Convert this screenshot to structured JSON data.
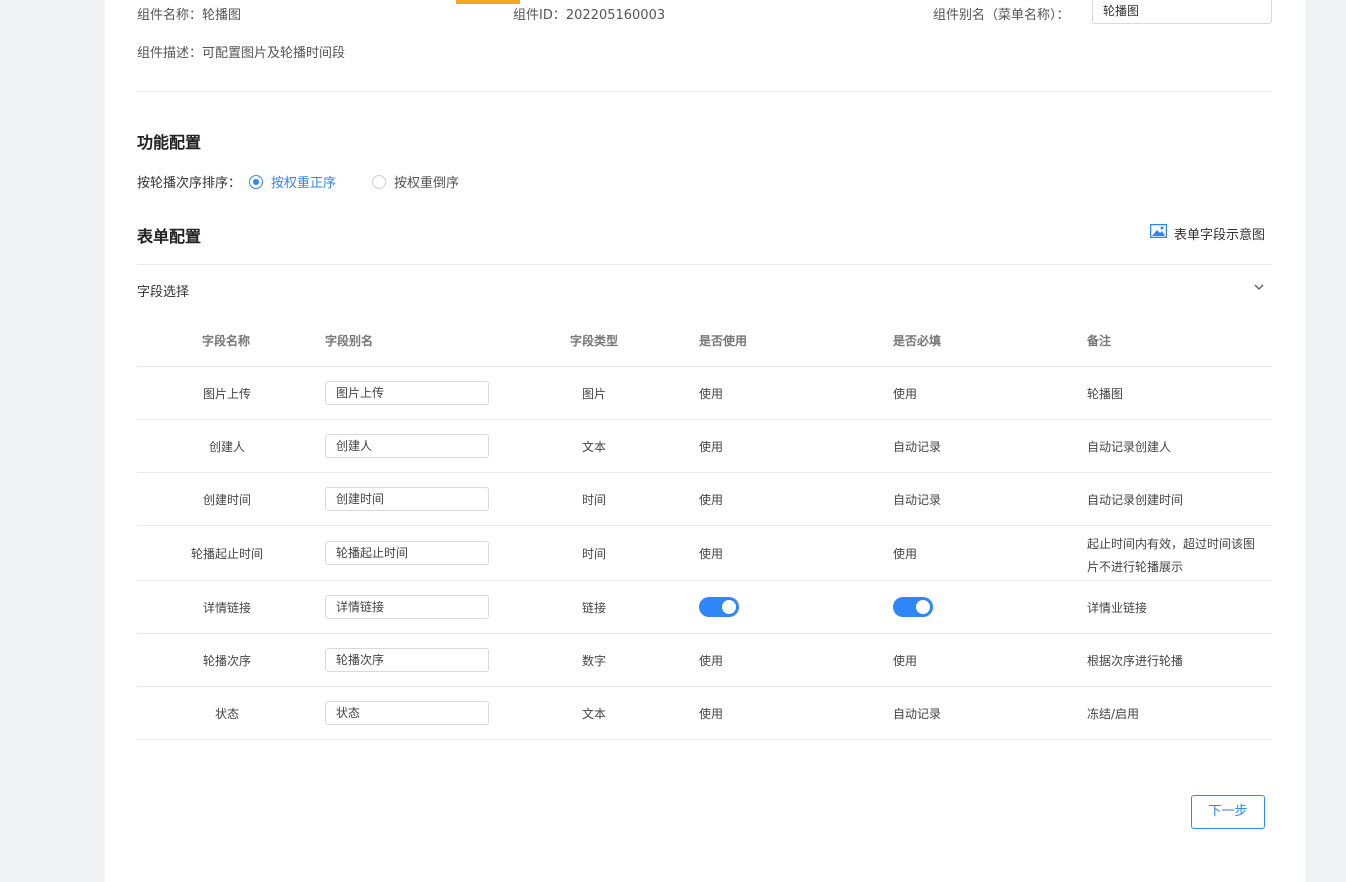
{
  "component": {
    "name_label": "组件名称：",
    "name_value": "轮播图",
    "id_label": "组件ID：",
    "id_value": "202205160003",
    "alias_label": "组件别名（菜单名称）：",
    "alias_value": "轮播图",
    "desc_label": "组件描述：",
    "desc_value": "可配置图片及轮播时间段"
  },
  "function_config": {
    "title": "功能配置",
    "sort_label": "按轮播次序排序：",
    "options": [
      {
        "label": "按权重正序",
        "selected": true
      },
      {
        "label": "按权重倒序",
        "selected": false
      }
    ]
  },
  "form_config": {
    "title": "表单配置",
    "schematic_label": "表单字段示意图",
    "field_select_label": "字段选择",
    "columns": [
      "字段名称",
      "字段别名",
      "字段类型",
      "是否使用",
      "是否必填",
      "备注"
    ],
    "rows": [
      {
        "name": "图片上传",
        "alias": "图片上传",
        "type": "图片",
        "use": "使用",
        "required": "使用",
        "note": "轮播图",
        "toggles": false
      },
      {
        "name": "创建人",
        "alias": "创建人",
        "type": "文本",
        "use": "使用",
        "required": "自动记录",
        "note": "自动记录创建人",
        "toggles": false
      },
      {
        "name": "创建时间",
        "alias": "创建时间",
        "type": "时间",
        "use": "使用",
        "required": "自动记录",
        "note": "自动记录创建时间",
        "toggles": false
      },
      {
        "name": "轮播起止时间",
        "alias": "轮播起止时间",
        "type": "时间",
        "use": "使用",
        "required": "使用",
        "note_line1": "起止时间内有效，超过时间该图",
        "note_line2": "片不进行轮播展示",
        "toggles": false
      },
      {
        "name": "详情链接",
        "alias": "详情链接",
        "type": "链接",
        "use_on": true,
        "required_on": true,
        "note": "详情业链接",
        "toggles": true
      },
      {
        "name": "轮播次序",
        "alias": "轮播次序",
        "type": "数字",
        "use": "使用",
        "required": "使用",
        "note": "根据次序进行轮播",
        "toggles": false
      },
      {
        "name": "状态",
        "alias": "状态",
        "type": "文本",
        "use": "使用",
        "required": "自动记录",
        "note": "冻结/启用",
        "toggles": false
      }
    ]
  },
  "actions": {
    "next_label": "下一步"
  },
  "colors": {
    "accent": "#2f86f6",
    "tab_indicator": "#f5a623"
  }
}
